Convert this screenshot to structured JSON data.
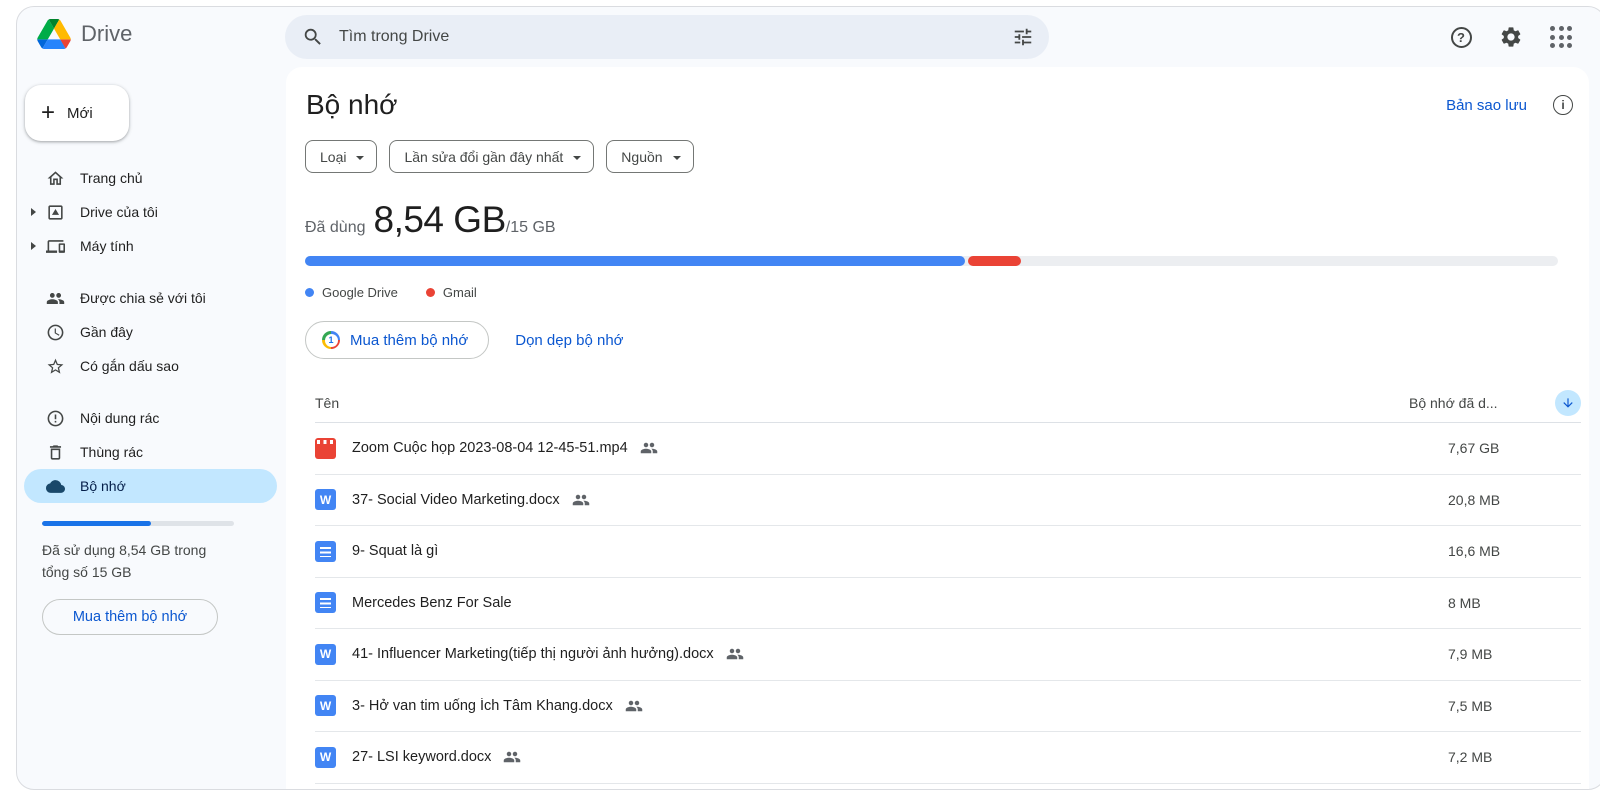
{
  "header": {
    "app_name": "Drive",
    "search_placeholder": "Tìm trong Drive",
    "icons": {
      "search": "search-icon (magnifier)",
      "advanced_search": "tune-sliders-icon",
      "help": "help-question-icon",
      "settings": "gear-icon",
      "apps": "apps-grid-icon (3x3 dots)"
    }
  },
  "sidebar": {
    "new_button": "Mới",
    "groups": [
      {
        "items": [
          {
            "label": "Trang chủ",
            "icon": "home-icon"
          },
          {
            "label": "Drive của tôi",
            "icon": "my-drive-icon",
            "expandable": "true"
          },
          {
            "label": "Máy tính",
            "icon": "computers-icon",
            "expandable": "true"
          }
        ]
      },
      {
        "items": [
          {
            "label": "Được chia sẻ với tôi",
            "icon": "shared-people-icon"
          },
          {
            "label": "Gần đây",
            "icon": "clock-icon"
          },
          {
            "label": "Có gắn dấu sao",
            "icon": "star-icon"
          }
        ]
      },
      {
        "items": [
          {
            "label": "Nội dung rác",
            "icon": "spam-exclamation-icon"
          },
          {
            "label": "Thùng rác",
            "icon": "trash-icon"
          },
          {
            "label": "Bộ nhớ",
            "icon": "cloud-icon",
            "selected": "true"
          }
        ]
      }
    ],
    "storage_progress_percent": 57,
    "storage_note_line1": "Đã sử dụng 8,54 GB trong",
    "storage_note_line2": "tổng số 15 GB",
    "buy_storage_button": "Mua thêm bộ nhớ"
  },
  "main": {
    "title": "Bộ nhớ",
    "backup_link": "Bản sao lưu",
    "filters": [
      {
        "label": "Loại"
      },
      {
        "label": "Lần sửa đổi gần đây nhất"
      },
      {
        "label": "Nguồn"
      }
    ],
    "usage": {
      "prefix": "Đã dùng",
      "used": "8,54 GB",
      "total": "/15 GB",
      "drive_pct": 52.7,
      "gmail_pct": 4.2
    },
    "legend": [
      {
        "label": "Google Drive",
        "color": "#4285f4"
      },
      {
        "label": "Gmail",
        "color": "#ea4335"
      }
    ],
    "buy_button": "Mua thêm bộ nhớ",
    "clean_link": "Dọn dẹp bộ nhớ",
    "table": {
      "name_header": "Tên",
      "storage_header": "Bộ nhớ đã d...",
      "sort_icon": "arrow-down-icon",
      "rows": [
        {
          "name": "Zoom Cuộc họp 2023-08-04 12-45-51.mp4",
          "size": "7,67 GB",
          "icon": "video-file-icon",
          "icon_class": "fileicon video",
          "shared": "true"
        },
        {
          "name": "37- Social Video Marketing.docx",
          "size": "20,8 MB",
          "icon": "word-file-icon",
          "icon_class": "fileicon word",
          "shared": "true"
        },
        {
          "name": "9- Squat là gì",
          "size": "16,6 MB",
          "icon": "google-doc-icon",
          "icon_class": "fileicon gdoc",
          "shared": "false"
        },
        {
          "name": "Mercedes Benz For Sale",
          "size": "8 MB",
          "icon": "google-doc-icon",
          "icon_class": "fileicon gdoc",
          "shared": "false"
        },
        {
          "name": "41- Influencer Marketing(tiếp thị người ảnh hưởng).docx",
          "size": "7,9 MB",
          "icon": "word-file-icon",
          "icon_class": "fileicon word",
          "shared": "true"
        },
        {
          "name": "3- Hở van tim uống Ích Tâm Khang.docx",
          "size": "7,5 MB",
          "icon": "word-file-icon",
          "icon_class": "fileicon word",
          "shared": "true"
        },
        {
          "name": "27- LSI keyword.docx",
          "size": "7,2 MB",
          "icon": "word-file-icon",
          "icon_class": "fileicon word",
          "shared": "true"
        }
      ]
    }
  },
  "colors": {
    "accent_blue": "#0b57d0",
    "drive_bar_blue": "#4285f4",
    "gmail_red": "#ea4335",
    "selected_pill": "#c2e7ff",
    "surface": "#f8fafd",
    "search_bg": "#e9eef6"
  }
}
